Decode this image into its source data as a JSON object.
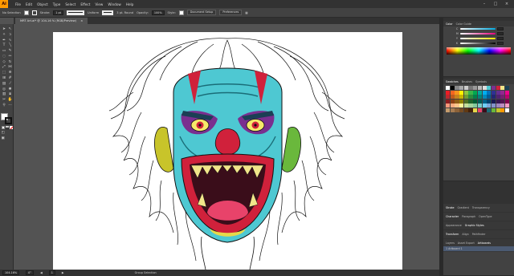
{
  "app": {
    "logo": "Ai"
  },
  "menubar": {
    "items": [
      "File",
      "Edit",
      "Object",
      "Type",
      "Select",
      "Effect",
      "View",
      "Window",
      "Help"
    ]
  },
  "controlbar": {
    "selection": "No Selection",
    "stroke_label": "Stroke:",
    "stroke_value": "1 pt",
    "uniform": "Uniform",
    "brush": "3 pt. Round",
    "opacity_label": "Opacity:",
    "opacity_value": "100%",
    "style_label": "Style:",
    "document_setup": "Document Setup",
    "preferences": "Preferences"
  },
  "document_tab": {
    "title": "MRT Art.ai* @ 104.16 % (RGB/Preview)",
    "close": "×"
  },
  "statusbar": {
    "zoom": "104.16%",
    "rotation": "0°",
    "artboard_nav": "1",
    "tool_name": "Group Selection"
  },
  "panels": {
    "color": {
      "tabs": [
        "Color",
        "Color Guide"
      ],
      "sliders": [
        "C",
        "M",
        "Y",
        "K"
      ]
    },
    "swatches": {
      "tabs": [
        "Swatches",
        "Brushes",
        "Symbols"
      ]
    },
    "stroke": {
      "tabs": [
        "Stroke",
        "Gradient",
        "Transparency"
      ]
    },
    "character": {
      "tabs": [
        "Character",
        "Paragraph",
        "OpenType"
      ]
    },
    "appearance": {
      "tabs": [
        "Appearance",
        "Graphic Styles"
      ]
    },
    "transform": {
      "tabs": [
        "Transform",
        "Align",
        "Pathfinder"
      ]
    },
    "layers": {
      "tabs": [
        "Layers",
        "Asset Export",
        "Artboards"
      ],
      "artboard_row": "1    Artboard 1"
    }
  },
  "colors": {
    "menubar": "#323232",
    "panel": "#424242",
    "canvas": "#535353",
    "accent": "#ff9a00"
  },
  "icons": {
    "tools": [
      "selection-tool-icon",
      "direct-selection-tool-icon",
      "magic-wand-icon",
      "lasso-icon",
      "pen-tool-icon",
      "curvature-icon",
      "type-tool-icon",
      "line-tool-icon",
      "rectangle-tool-icon",
      "paintbrush-icon",
      "shaper-icon",
      "pencil-icon",
      "eraser-icon",
      "rotate-icon",
      "scale-icon",
      "width-icon",
      "free-transform-icon",
      "shape-builder-icon",
      "perspective-icon",
      "mesh-icon",
      "gradient-icon",
      "eyedropper-icon",
      "blend-icon",
      "symbol-sprayer-icon",
      "graph-icon",
      "artboard-tool-icon",
      "slice-icon",
      "hand-icon",
      "zoom-icon",
      "edit-toolbar-icon"
    ]
  }
}
